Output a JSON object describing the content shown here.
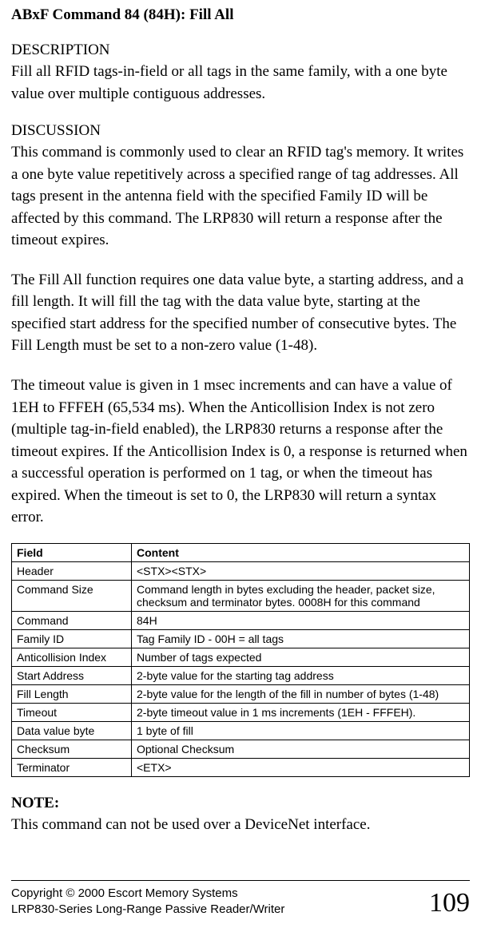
{
  "title": "ABxF Command 84 (84H): Fill All",
  "sections": {
    "description": {
      "label": "DESCRIPTION",
      "text": "Fill all RFID tags-in-field or all tags in the same family, with a one byte value over multiple contiguous addresses."
    },
    "discussion": {
      "label": "DISCUSSION",
      "p1": "This command is commonly used to clear an RFID tag's memory. It writes a one byte value repetitively across a specified range of tag addresses. All tags present in the antenna field with the specified Family ID will be affected by this command. The LRP830 will return a response after the timeout expires.",
      "p2": "The Fill All function requires one data value byte, a starting address, and a fill length. It will fill the tag with the data value byte, starting at the specified start address for the specified number of consecutive bytes. The Fill Length must be set to a non-zero value (1-48).",
      "p3": " The timeout value is given in 1 msec increments and can have a value of 1EH to FFFEH (65,534 ms).  When the Anticollision Index is not zero (multiple tag-in-field enabled), the LRP830 returns a response after the timeout expires. If the Anticollision Index is 0, a response is returned when a successful operation is performed on 1 tag, or when the timeout has expired. When the timeout is set to 0, the LRP830 will return a syntax error."
    }
  },
  "table": {
    "headers": {
      "field": "Field",
      "content": "Content"
    },
    "rows": [
      {
        "field": "Header",
        "content": "<STX><STX>"
      },
      {
        "field": "Command Size",
        "content": "Command length in bytes excluding the header, packet size, checksum and terminator bytes. 0008H for this command"
      },
      {
        "field": "Command",
        "content": "84H"
      },
      {
        "field": "Family ID",
        "content": "Tag Family ID - 00H = all tags"
      },
      {
        "field": "Anticollision Index",
        "content": "Number of tags expected"
      },
      {
        "field": "Start Address",
        "content": "2-byte value for the starting tag address"
      },
      {
        "field": "Fill Length",
        "content": "2-byte value for the length of the fill in number of bytes (1-48)"
      },
      {
        "field": "Timeout",
        "content": "2-byte timeout value in 1 ms increments (1EH - FFFEH)."
      },
      {
        "field": "Data value byte",
        "content": "1 byte of fill"
      },
      {
        "field": "Checksum",
        "content": "Optional Checksum"
      },
      {
        "field": "Terminator",
        "content": "<ETX>"
      }
    ]
  },
  "note": {
    "label": "NOTE:",
    "text": "This command can not be used over a DeviceNet interface."
  },
  "footer": {
    "line1": "Copyright © 2000 Escort Memory Systems",
    "line2": "LRP830-Series Long-Range Passive Reader/Writer",
    "page": "109"
  }
}
